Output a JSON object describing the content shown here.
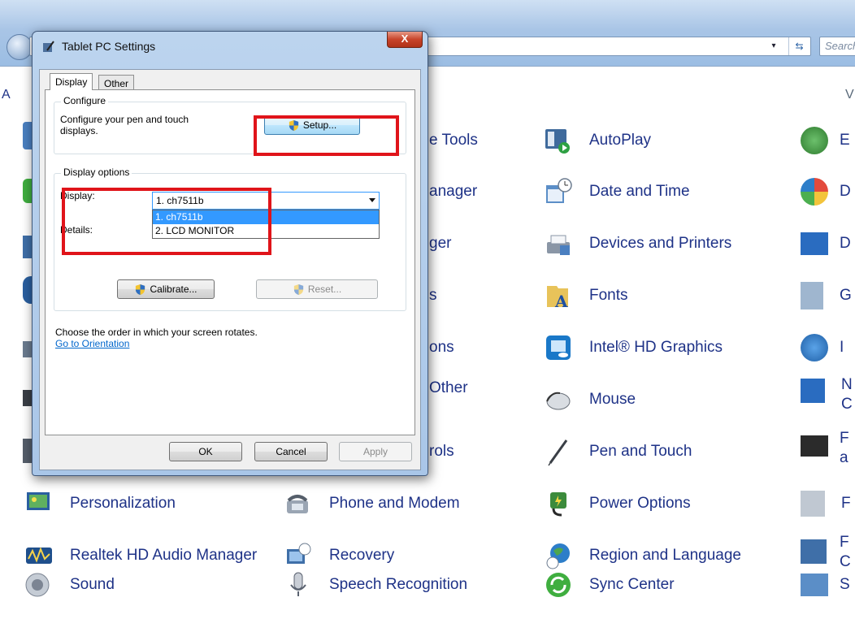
{
  "explorer": {
    "search_placeholder": "Search",
    "left_header_fragment": "A",
    "right_header_fragment": "V"
  },
  "control_panel_items": {
    "partial_tools": "e Tools",
    "partial_manager": "anager",
    "partial_ger": "ger",
    "partial_s": "s",
    "partial_ons": "ons",
    "partial_other": "Other",
    "partial_rols": "rols",
    "autoplay": "AutoPlay",
    "date_time": "Date and Time",
    "devices_printers": "Devices and Printers",
    "fonts": "Fonts",
    "intel_graphics": "Intel® HD Graphics",
    "mouse": "Mouse",
    "pen_touch": "Pen and Touch",
    "power_options": "Power Options",
    "personalization": "Personalization",
    "phone_modem": "Phone and Modem",
    "realtek": "Realtek HD Audio Manager",
    "recovery": "Recovery",
    "region_language": "Region and Language",
    "sound": "Sound",
    "speech_recognition": "Speech Recognition",
    "sync_center": "Sync Center",
    "right_col": [
      "E",
      "D",
      "D",
      "G",
      "I",
      "N",
      "F",
      "F",
      "F",
      "S"
    ],
    "right_col_second": [
      "C",
      "a",
      "C"
    ]
  },
  "dialog": {
    "title": "Tablet PC Settings",
    "close_glyph": "X",
    "tabs": [
      "Display",
      "Other"
    ],
    "configure": {
      "legend": "Configure",
      "description_line1": "Configure your pen and touch",
      "description_line2": "displays.",
      "setup_button": "Setup..."
    },
    "display_options": {
      "legend": "Display options",
      "display_label": "Display:",
      "display_value": "1. ch7511b",
      "options": [
        "1. ch7511b",
        "2. LCD MONITOR"
      ],
      "details_label": "Details:",
      "calibrate_button": "Calibrate...",
      "reset_button": "Reset..."
    },
    "orientation_text": "Choose the order in which your screen rotates.",
    "orientation_link": "Go to Orientation",
    "buttons": {
      "ok": "OK",
      "cancel": "Cancel",
      "apply": "Apply"
    }
  },
  "colors": {
    "highlight": "#e0141a",
    "link": "#1e3287",
    "selection": "#3399ff"
  }
}
